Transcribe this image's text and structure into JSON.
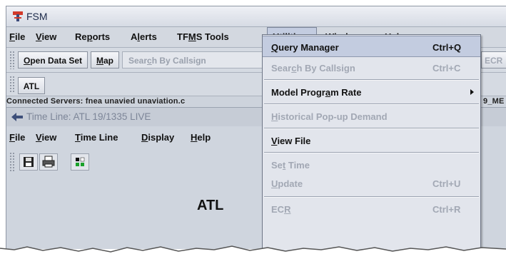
{
  "main_window": {
    "title": "FSM",
    "menus": [
      {
        "pre": "",
        "u": "F",
        "post": "ile"
      },
      {
        "pre": "",
        "u": "V",
        "post": "iew"
      },
      {
        "pre": "Re",
        "u": "p",
        "post": "orts"
      },
      {
        "pre": "A",
        "u": "l",
        "post": "erts"
      },
      {
        "pre": "TF",
        "u": "M",
        "post": "S Tools"
      },
      {
        "pre": "",
        "u": "U",
        "post": "tilities"
      },
      {
        "pre": "",
        "u": "W",
        "post": "indow"
      },
      {
        "pre": "",
        "u": "H",
        "post": "elp"
      }
    ],
    "toolbar": {
      "open_data_set": {
        "pre": "",
        "u": "O",
        "post": "pen Data Set"
      },
      "map": {
        "pre": "",
        "u": "M",
        "post": "ap"
      },
      "search_placeholder": {
        "pre": "Sear",
        "u": "c",
        "post": "h By Callsign"
      },
      "airport_button": "ATL",
      "ecr_partial": "ECR"
    },
    "status_text": "Connected Servers: fnea unavied unaviation.c",
    "status_trailing": "9_ME"
  },
  "utilities_menu": {
    "items": [
      {
        "pre": "",
        "u": "Q",
        "post": "uery Manager",
        "shortcut": "Ctrl+Q",
        "enabled": true,
        "highlighted": true
      },
      {
        "pre": "Sear",
        "u": "c",
        "post": "h By Callsign",
        "shortcut": "Ctrl+C",
        "enabled": false
      },
      {
        "pre": "Model Progr",
        "u": "a",
        "post": "m Rate",
        "shortcut": "",
        "enabled": true,
        "submenu": true
      },
      {
        "pre": "",
        "u": "H",
        "post": "istorical Pop-up Demand",
        "shortcut": "",
        "enabled": false
      },
      {
        "pre": "",
        "u": "V",
        "post": "iew File",
        "shortcut": "",
        "enabled": true
      },
      {
        "pre": "Se",
        "u": "t",
        "post": " Time",
        "shortcut": "",
        "enabled": false
      },
      {
        "pre": "",
        "u": "U",
        "post": "pdate",
        "shortcut": "Ctrl+U",
        "enabled": false
      },
      {
        "pre": "EC",
        "u": "R",
        "post": "",
        "shortcut": "Ctrl+R",
        "enabled": false
      }
    ]
  },
  "timeline_window": {
    "title": "Time Line: ATL 19/1335 LIVE",
    "menus": [
      {
        "pre": "",
        "u": "F",
        "post": "ile"
      },
      {
        "pre": "",
        "u": "V",
        "post": "iew"
      },
      {
        "pre": "",
        "u": "T",
        "post": "ime Line"
      },
      {
        "pre": "",
        "u": "D",
        "post": "isplay"
      },
      {
        "pre": "",
        "u": "H",
        "post": "elp"
      }
    ],
    "airport_label": "ATL"
  },
  "colors": {
    "menu_highlight": "#c3cce0",
    "disabled_text": "#a2a8b4",
    "window_bg": "#cfd5de"
  },
  "icons": [
    "fsm-app-icon",
    "timeline-app-icon",
    "save-icon",
    "print-icon",
    "display-grid-icon",
    "submenu-arrow-icon"
  ]
}
